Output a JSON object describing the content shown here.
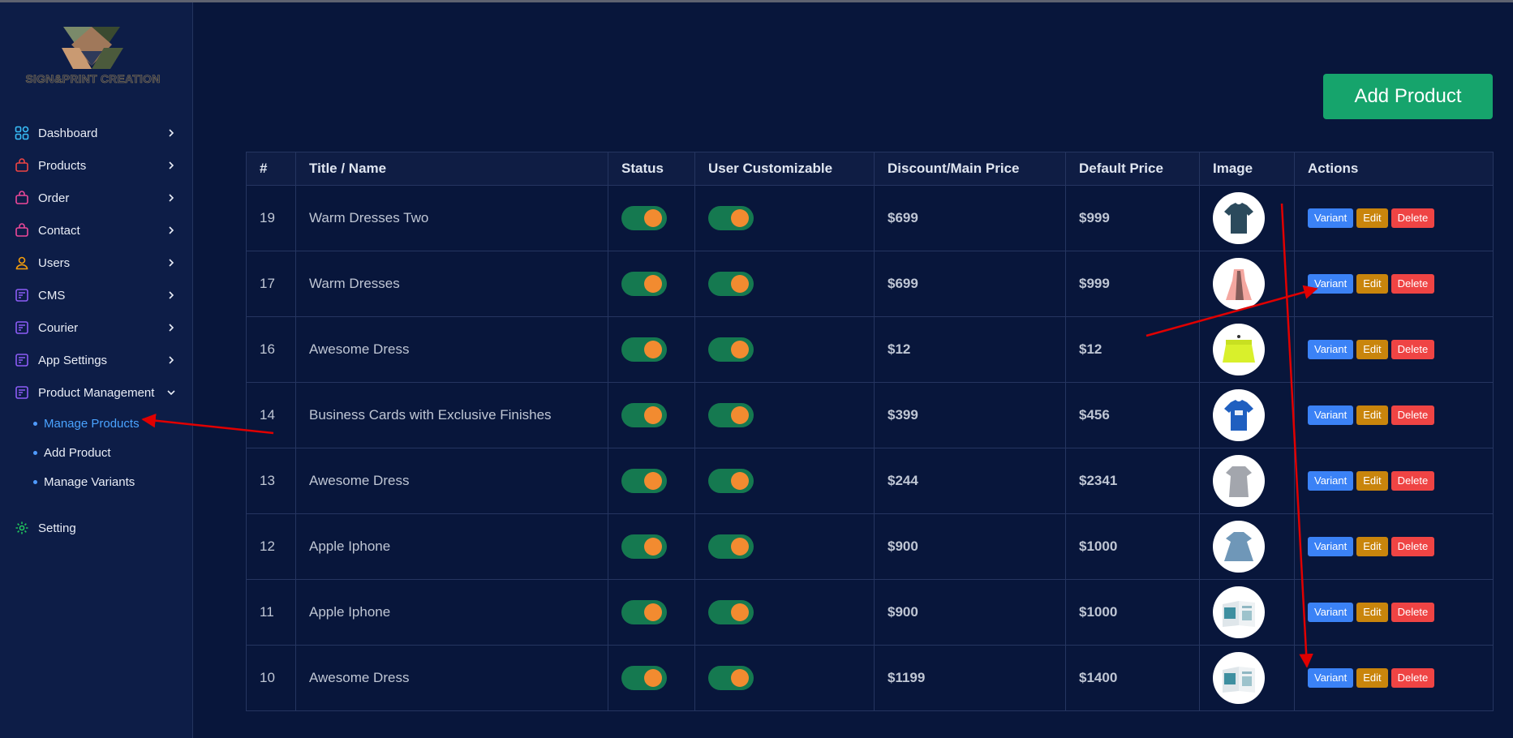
{
  "brand": {
    "logo_text": "SIGN&PRINT CREATION"
  },
  "sidebar": {
    "items": [
      {
        "label": "Dashboard",
        "icon": "dashboard-icon",
        "color": "#38bdf8"
      },
      {
        "label": "Products",
        "icon": "bag-icon",
        "color": "#ef4444"
      },
      {
        "label": "Order",
        "icon": "bag-icon",
        "color": "#ec4899"
      },
      {
        "label": "Contact",
        "icon": "bag-icon",
        "color": "#ec4899"
      },
      {
        "label": "Users",
        "icon": "user-icon",
        "color": "#f59e0b"
      },
      {
        "label": "CMS",
        "icon": "document-icon",
        "color": "#8b5cf6"
      },
      {
        "label": "Courier",
        "icon": "document-icon",
        "color": "#8b5cf6"
      },
      {
        "label": "App Settings",
        "icon": "document-icon",
        "color": "#8b5cf6"
      },
      {
        "label": "Product Management",
        "icon": "document-icon",
        "color": "#8b5cf6"
      }
    ],
    "submenu": [
      {
        "label": "Manage Products",
        "active": true
      },
      {
        "label": "Add Product",
        "active": false
      },
      {
        "label": "Manage Variants",
        "active": false
      }
    ],
    "setting": {
      "label": "Setting",
      "icon": "gear-icon",
      "color": "#22c55e"
    }
  },
  "main": {
    "add_button": "Add Product",
    "table": {
      "headers": [
        "#",
        "Title / Name",
        "Status",
        "User Customizable",
        "Discount/Main Price",
        "Default Price",
        "Image",
        "Actions"
      ],
      "rows": [
        {
          "id": "19",
          "title": "Warm Dresses Two",
          "status": true,
          "customizable": true,
          "discount_price": "$699",
          "default_price": "$999",
          "image": "dark-tshirt"
        },
        {
          "id": "17",
          "title": "Warm Dresses",
          "status": true,
          "customizable": true,
          "discount_price": "$699",
          "default_price": "$999",
          "image": "pink-dress"
        },
        {
          "id": "16",
          "title": "Awesome Dress",
          "status": true,
          "customizable": true,
          "discount_price": "$12",
          "default_price": "$12",
          "image": "yellow-skirt"
        },
        {
          "id": "14",
          "title": "Business Cards with Exclusive Finishes",
          "status": true,
          "customizable": true,
          "discount_price": "$399",
          "default_price": "$456",
          "image": "blue-tshirt"
        },
        {
          "id": "13",
          "title": "Awesome Dress",
          "status": true,
          "customizable": true,
          "discount_price": "$244",
          "default_price": "$2341",
          "image": "grey-dress"
        },
        {
          "id": "12",
          "title": "Apple Iphone",
          "status": true,
          "customizable": true,
          "discount_price": "$900",
          "default_price": "$1000",
          "image": "denim-dress"
        },
        {
          "id": "11",
          "title": "Apple Iphone",
          "status": true,
          "customizable": true,
          "discount_price": "$900",
          "default_price": "$1000",
          "image": "brochure"
        },
        {
          "id": "10",
          "title": "Awesome Dress",
          "status": true,
          "customizable": true,
          "discount_price": "$1199",
          "default_price": "$1400",
          "image": "brochure"
        }
      ],
      "actions": {
        "variant": "Variant",
        "edit": "Edit",
        "delete": "Delete"
      }
    }
  },
  "colors": {
    "background": "#08163b",
    "sidebar": "#0d1d47",
    "accent_green": "#16a46c",
    "toggle_on": "#157950",
    "toggle_knob": "#f28b30",
    "variant": "#3b82f6",
    "edit": "#c9850c",
    "delete": "#ef4444",
    "annotation_arrow": "#e00000",
    "active_link": "#4aa3ff"
  }
}
